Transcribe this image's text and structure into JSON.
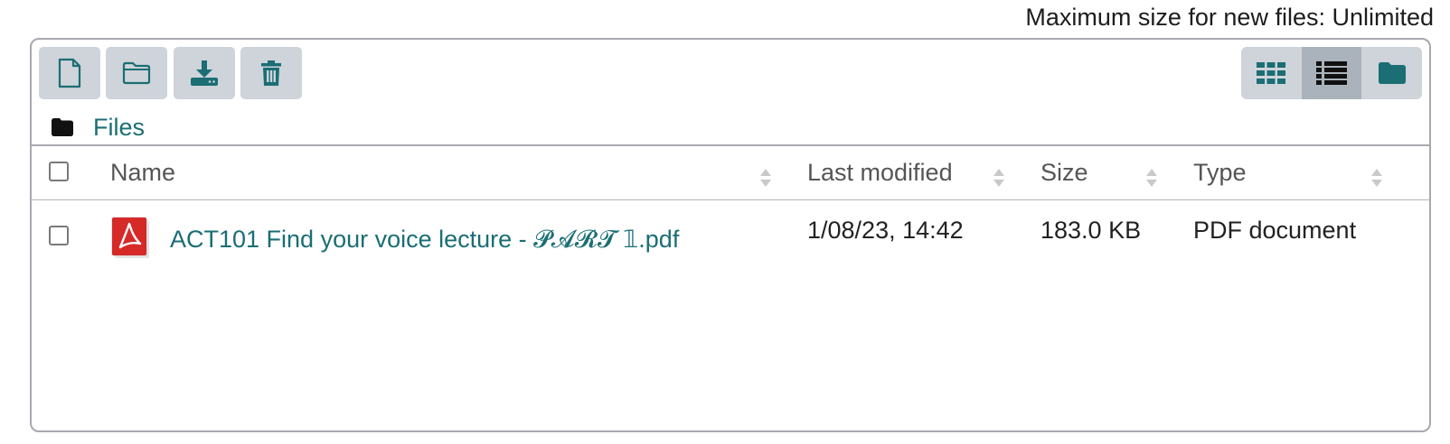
{
  "upload_limit": {
    "text": "Maximum size for new files: Unlimited"
  },
  "toolbar": {
    "buttons": [
      {
        "name": "add-file",
        "icon": "file-icon"
      },
      {
        "name": "create-folder",
        "icon": "folder-icon"
      },
      {
        "name": "download",
        "icon": "download-icon"
      },
      {
        "name": "delete",
        "icon": "trash-icon"
      }
    ],
    "views": [
      {
        "name": "icons-view",
        "icon": "grid-icon",
        "active": false
      },
      {
        "name": "list-view",
        "icon": "list-icon",
        "active": true
      },
      {
        "name": "tree-view",
        "icon": "folder-filled-icon",
        "active": false
      }
    ]
  },
  "breadcrumb": {
    "label": "Files"
  },
  "table": {
    "columns": [
      "Name",
      "Last modified",
      "Size",
      "Type"
    ],
    "rows": [
      {
        "name": "ACT101 Find your voice lecture - 𝓟𝓐𝓡𝓣 𝟙.pdf",
        "modified": "1/08/23, 14:42",
        "size": "183.0 KB",
        "type": "PDF document",
        "icon": "pdf-icon"
      }
    ]
  },
  "colors": {
    "accent": "#1a6e74",
    "button_bg": "#ced4da",
    "active_view": "#aab3bb"
  }
}
